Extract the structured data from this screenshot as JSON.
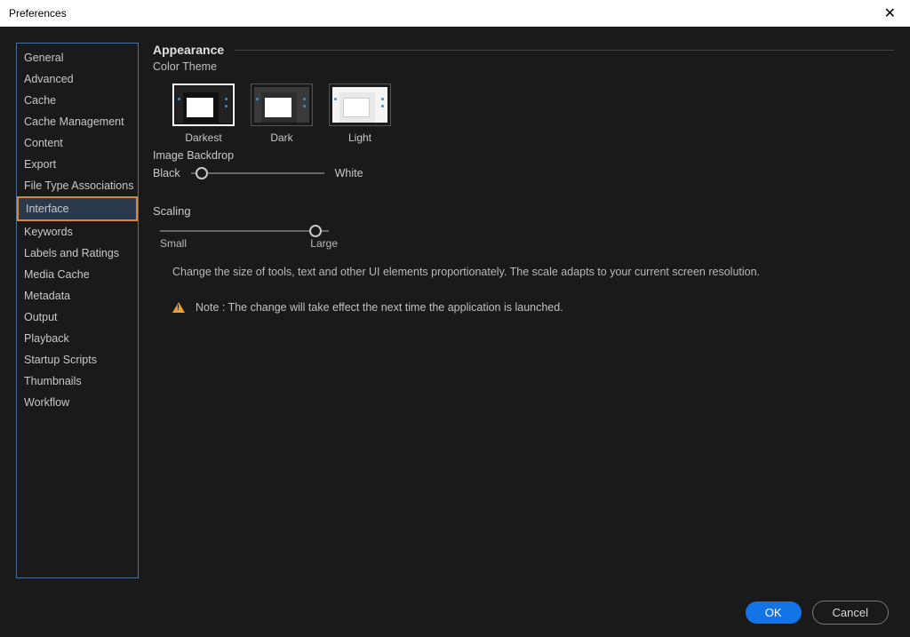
{
  "dialog": {
    "title": "Preferences"
  },
  "sidebar": {
    "items": [
      {
        "label": "General"
      },
      {
        "label": "Advanced"
      },
      {
        "label": "Cache"
      },
      {
        "label": "Cache Management"
      },
      {
        "label": "Content"
      },
      {
        "label": "Export"
      },
      {
        "label": "File Type Associations"
      },
      {
        "label": "Interface",
        "selected": true
      },
      {
        "label": "Keywords"
      },
      {
        "label": "Labels and Ratings"
      },
      {
        "label": "Media Cache"
      },
      {
        "label": "Metadata"
      },
      {
        "label": "Output"
      },
      {
        "label": "Playback"
      },
      {
        "label": "Startup Scripts"
      },
      {
        "label": "Thumbnails"
      },
      {
        "label": "Workflow"
      }
    ]
  },
  "appearance": {
    "section_title": "Appearance",
    "color_theme_label": "Color Theme",
    "themes": [
      {
        "name": "Darkest",
        "selected": true
      },
      {
        "name": "Dark"
      },
      {
        "name": "Light"
      }
    ],
    "backdrop": {
      "label": "Image Backdrop",
      "left": "Black",
      "right": "White",
      "value_percent": 8
    }
  },
  "scaling": {
    "title": "Scaling",
    "labels": {
      "left": "Small",
      "right": "Large"
    },
    "value_percent": 92,
    "description": "Change the size of tools, text and other UI elements proportionately. The scale adapts to your current screen resolution.",
    "note": "Note : The change will take effect the next time the application is launched."
  },
  "footer": {
    "ok": "OK",
    "cancel": "Cancel"
  }
}
